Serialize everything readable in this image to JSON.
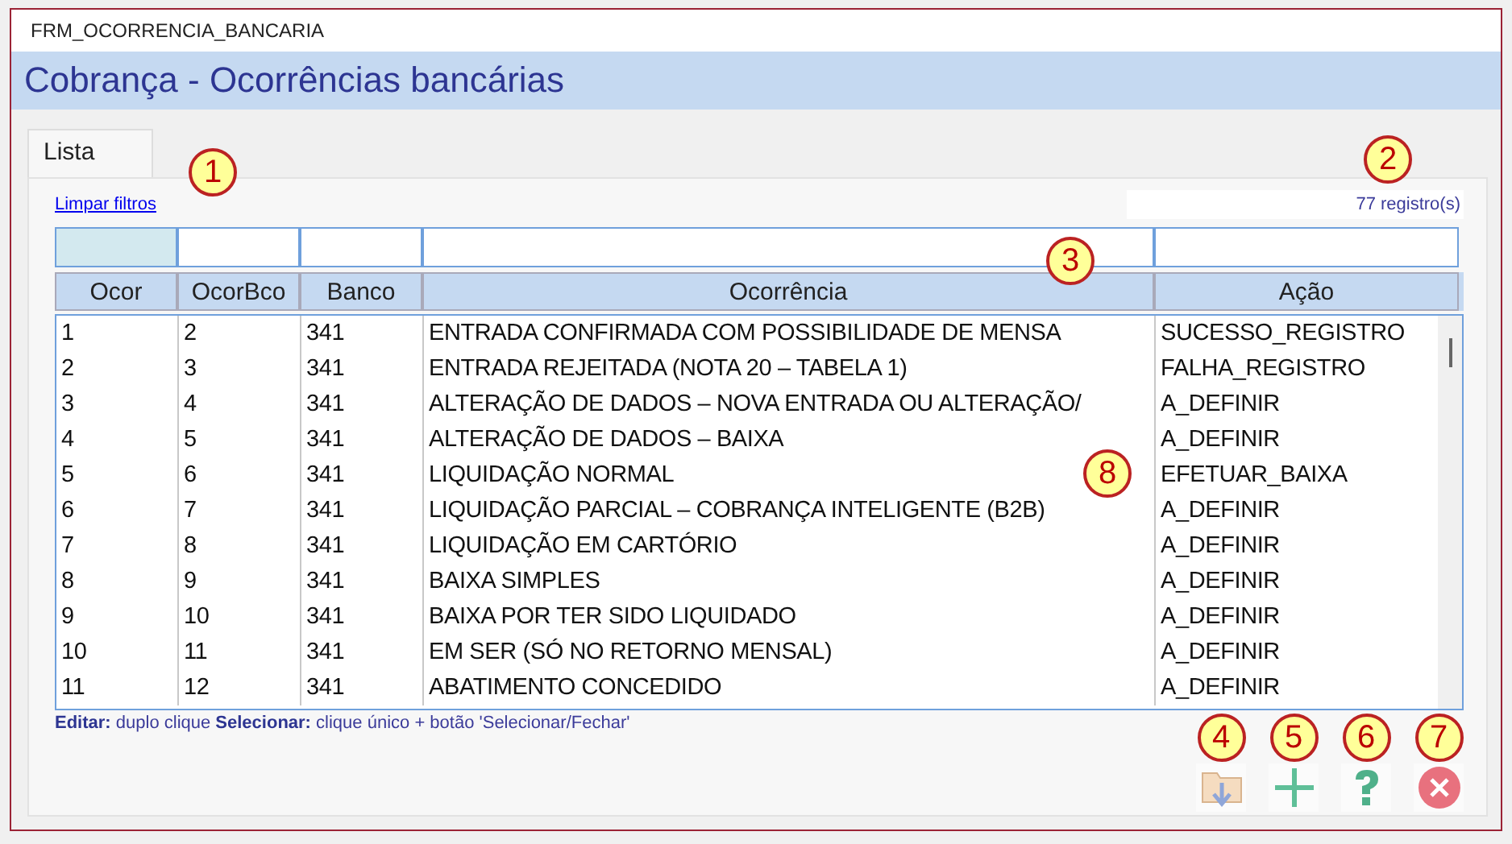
{
  "window": {
    "title": "FRM_OCORRENCIA_BANCARIA"
  },
  "header": {
    "title": "Cobrança - Ocorrências bancárias"
  },
  "tabs": [
    {
      "label": "Lista",
      "selected": true
    }
  ],
  "clear_filters_link": "Limpar filtros",
  "record_count": "77 registro(s)",
  "table": {
    "columns": [
      "Ocor",
      "OcorBco",
      "Banco",
      "Ocorrência",
      "Ação"
    ],
    "rows": [
      [
        "1",
        "2",
        "341",
        "ENTRADA CONFIRMADA COM POSSIBILIDADE DE MENSA",
        "SUCESSO_REGISTRO"
      ],
      [
        "2",
        "3",
        "341",
        "ENTRADA REJEITADA (NOTA 20 – TABELA 1)",
        "FALHA_REGISTRO"
      ],
      [
        "3",
        "4",
        "341",
        "ALTERAÇÃO DE DADOS – NOVA ENTRADA OU ALTERAÇÃO/",
        "A_DEFINIR"
      ],
      [
        "4",
        "5",
        "341",
        "ALTERAÇÃO DE DADOS – BAIXA",
        "A_DEFINIR"
      ],
      [
        "5",
        "6",
        "341",
        "LIQUIDAÇÃO NORMAL",
        "EFETUAR_BAIXA"
      ],
      [
        "6",
        "7",
        "341",
        "LIQUIDAÇÃO PARCIAL – COBRANÇA INTELIGENTE (B2B)",
        "A_DEFINIR"
      ],
      [
        "7",
        "8",
        "341",
        "LIQUIDAÇÃO EM CARTÓRIO",
        "A_DEFINIR"
      ],
      [
        "8",
        "9",
        "341",
        "BAIXA SIMPLES",
        "A_DEFINIR"
      ],
      [
        "9",
        "10",
        "341",
        "BAIXA POR TER SIDO LIQUIDADO",
        "A_DEFINIR"
      ],
      [
        "10",
        "11",
        "341",
        "EM SER (SÓ NO RETORNO MENSAL)",
        "A_DEFINIR"
      ],
      [
        "11",
        "12",
        "341",
        "ABATIMENTO CONCEDIDO",
        "A_DEFINIR"
      ]
    ]
  },
  "footer_hint": "**Editar:** duplo clique  **Selecionar:** clique único + botão 'Selecionar/Fechar'",
  "callouts": [
    "1",
    "2",
    "3",
    "4",
    "5",
    "6",
    "7",
    "8"
  ]
}
